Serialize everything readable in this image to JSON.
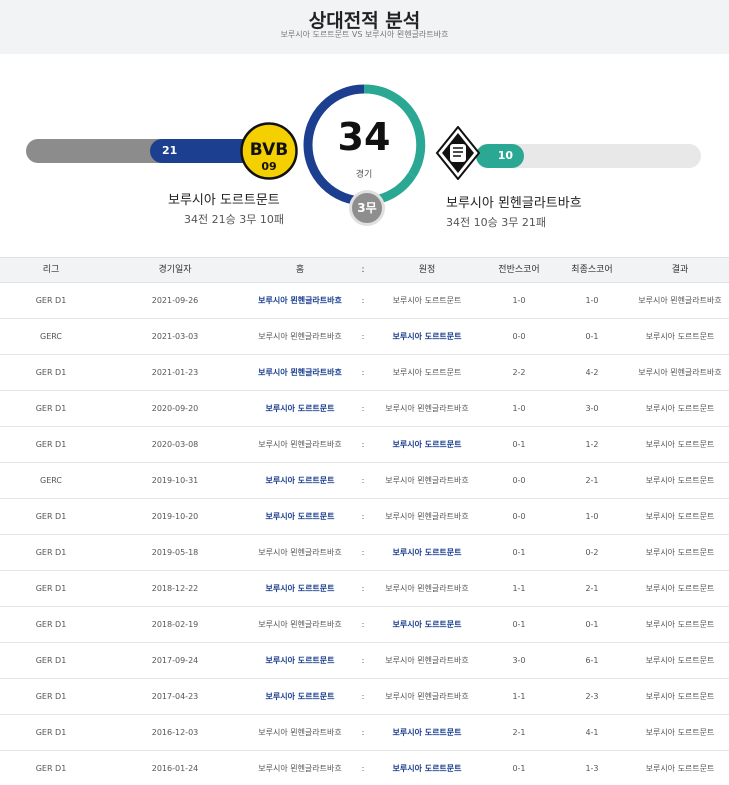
{
  "header": {
    "title": "상대전적 분석",
    "subtitle": "보루시아 도르트문트 VS 보루시아 묀헨글라트바흐"
  },
  "summary": {
    "total_games": "34",
    "total_label": "경기",
    "draws_label": "3무",
    "home": {
      "name": "보루시아 도르트문트",
      "record": "34전 21승 3무 10패",
      "wins": "21",
      "color": "#1d3f8f",
      "crest": "bvb-crest-icon"
    },
    "away": {
      "name": "보루시아 묀헨글라트바흐",
      "record": "34전 10승 3무 21패",
      "wins": "10",
      "color": "#2aa893",
      "crest": "gladbach-crest-icon"
    }
  },
  "table": {
    "headers": [
      "리그",
      "경기일자",
      "홈",
      ":",
      "원정",
      "전반스코어",
      "최종스코어",
      "결과"
    ],
    "rows": [
      {
        "league": "GER D1",
        "date": "2021-09-26",
        "home": "보루시아 묀헨글라트바흐",
        "sep": ":",
        "away": "보루시아 도르트문트",
        "half": "1-0",
        "full": "1-0",
        "result": "보루시아 묀헨글라트바흐",
        "winner": "home"
      },
      {
        "league": "GERC",
        "date": "2021-03-03",
        "home": "보루시아 묀헨글라트바흐",
        "sep": ":",
        "away": "보루시아 도르트문트",
        "half": "0-0",
        "full": "0-1",
        "result": "보루시아 도르트문트",
        "winner": "away"
      },
      {
        "league": "GER D1",
        "date": "2021-01-23",
        "home": "보루시아 묀헨글라트바흐",
        "sep": ":",
        "away": "보루시아 도르트문트",
        "half": "2-2",
        "full": "4-2",
        "result": "보루시아 묀헨글라트바흐",
        "winner": "home"
      },
      {
        "league": "GER D1",
        "date": "2020-09-20",
        "home": "보루시아 도르트문트",
        "sep": ":",
        "away": "보루시아 묀헨글라트바흐",
        "half": "1-0",
        "full": "3-0",
        "result": "보루시아 도르트문트",
        "winner": "home"
      },
      {
        "league": "GER D1",
        "date": "2020-03-08",
        "home": "보루시아 묀헨글라트바흐",
        "sep": ":",
        "away": "보루시아 도르트문트",
        "half": "0-1",
        "full": "1-2",
        "result": "보루시아 도르트문트",
        "winner": "away"
      },
      {
        "league": "GERC",
        "date": "2019-10-31",
        "home": "보루시아 도르트문트",
        "sep": ":",
        "away": "보루시아 묀헨글라트바흐",
        "half": "0-0",
        "full": "2-1",
        "result": "보루시아 도르트문트",
        "winner": "home"
      },
      {
        "league": "GER D1",
        "date": "2019-10-20",
        "home": "보루시아 도르트문트",
        "sep": ":",
        "away": "보루시아 묀헨글라트바흐",
        "half": "0-0",
        "full": "1-0",
        "result": "보루시아 도르트문트",
        "winner": "home"
      },
      {
        "league": "GER D1",
        "date": "2019-05-18",
        "home": "보루시아 묀헨글라트바흐",
        "sep": ":",
        "away": "보루시아 도르트문트",
        "half": "0-1",
        "full": "0-2",
        "result": "보루시아 도르트문트",
        "winner": "away"
      },
      {
        "league": "GER D1",
        "date": "2018-12-22",
        "home": "보루시아 도르트문트",
        "sep": ":",
        "away": "보루시아 묀헨글라트바흐",
        "half": "1-1",
        "full": "2-1",
        "result": "보루시아 도르트문트",
        "winner": "home"
      },
      {
        "league": "GER D1",
        "date": "2018-02-19",
        "home": "보루시아 묀헨글라트바흐",
        "sep": ":",
        "away": "보루시아 도르트문트",
        "half": "0-1",
        "full": "0-1",
        "result": "보루시아 도르트문트",
        "winner": "away"
      },
      {
        "league": "GER D1",
        "date": "2017-09-24",
        "home": "보루시아 도르트문트",
        "sep": ":",
        "away": "보루시아 묀헨글라트바흐",
        "half": "3-0",
        "full": "6-1",
        "result": "보루시아 도르트문트",
        "winner": "home"
      },
      {
        "league": "GER D1",
        "date": "2017-04-23",
        "home": "보루시아 도르트문트",
        "sep": ":",
        "away": "보루시아 묀헨글라트바흐",
        "half": "1-1",
        "full": "2-3",
        "result": "보루시아 도르트문트",
        "winner": "home"
      },
      {
        "league": "GER D1",
        "date": "2016-12-03",
        "home": "보루시아 묀헨글라트바흐",
        "sep": ":",
        "away": "보루시아 도르트문트",
        "half": "2-1",
        "full": "4-1",
        "result": "보루시아 도르트문트",
        "winner": "away"
      },
      {
        "league": "GER D1",
        "date": "2016-01-24",
        "home": "보루시아 묀헨글라트바흐",
        "sep": ":",
        "away": "보루시아 도르트문트",
        "half": "0-1",
        "full": "1-3",
        "result": "보루시아 도르트문트",
        "winner": "away"
      }
    ]
  }
}
